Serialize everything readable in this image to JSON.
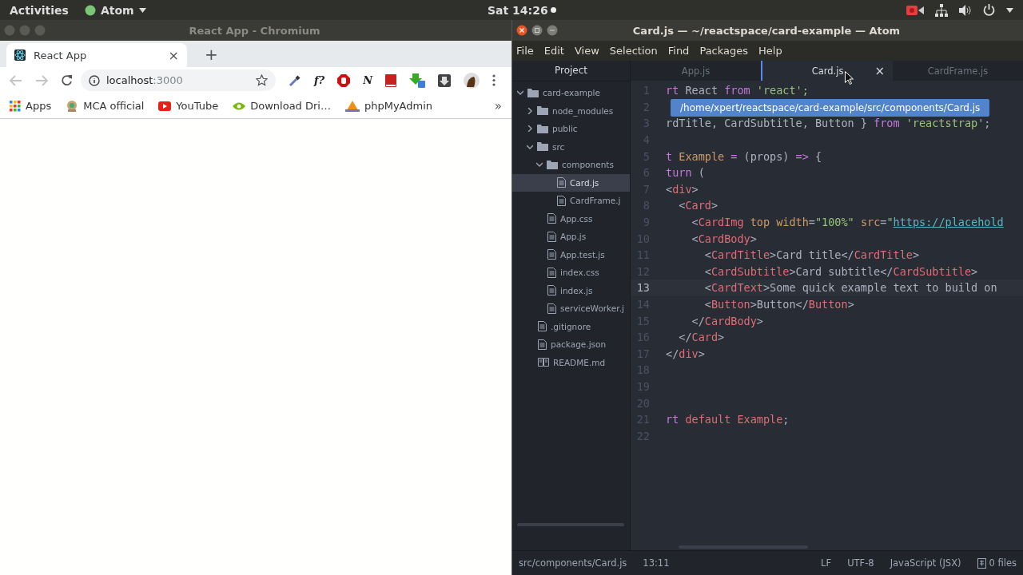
{
  "topbar": {
    "activities": "Activities",
    "app_menu": "Atom",
    "clock": "Sat 14:26"
  },
  "browser": {
    "title": "React App - Chromium",
    "tabs": [
      {
        "label": "React App",
        "close": "×",
        "selected": true
      }
    ],
    "new_tab": "+",
    "address": {
      "host": "localhost",
      "port": ":3000"
    },
    "extensions": [
      {
        "kind": "dropper"
      },
      {
        "kind": "text",
        "label": "f?"
      },
      {
        "kind": "stop"
      },
      {
        "kind": "text",
        "label": "N"
      },
      {
        "kind": "book"
      },
      {
        "kind": "green-download"
      },
      {
        "kind": "dark-download"
      },
      {
        "kind": "avatar"
      }
    ],
    "bookmarks": [
      {
        "kind": "apps",
        "label": "Apps"
      },
      {
        "kind": "emblem",
        "label": "MCA official"
      },
      {
        "kind": "youtube",
        "label": "YouTube"
      },
      {
        "kind": "eye",
        "label": "Download Dri…"
      },
      {
        "kind": "pma",
        "label": "phpMyAdmin"
      }
    ],
    "more": "»"
  },
  "atom": {
    "title": "Card.js — ~/reactspace/card-example — Atom",
    "menu": [
      "File",
      "Edit",
      "View",
      "Selection",
      "Find",
      "Packages",
      "Help"
    ],
    "project_tab": "Project",
    "tree": [
      {
        "name": "card-example",
        "kind": "folder",
        "expanded": true,
        "selected": false,
        "children": [
          {
            "name": "node_modules",
            "kind": "folder",
            "expanded": false,
            "selected": false
          },
          {
            "name": "public",
            "kind": "folder",
            "expanded": false,
            "selected": false
          },
          {
            "name": "src",
            "kind": "folder",
            "expanded": true,
            "selected": false,
            "children": [
              {
                "name": "components",
                "kind": "folder",
                "expanded": true,
                "selected": false,
                "children": [
                  {
                    "name": "Card.js",
                    "kind": "file",
                    "selected": true
                  },
                  {
                    "name": "CardFrame.j",
                    "kind": "file",
                    "selected": false
                  }
                ]
              },
              {
                "name": "App.css",
                "kind": "file",
                "selected": false
              },
              {
                "name": "App.js",
                "kind": "file",
                "selected": false
              },
              {
                "name": "App.test.js",
                "kind": "file",
                "selected": false
              },
              {
                "name": "index.css",
                "kind": "file",
                "selected": false
              },
              {
                "name": "index.js",
                "kind": "file",
                "selected": false
              },
              {
                "name": "serviceWorker.j",
                "kind": "file",
                "selected": false
              }
            ]
          },
          {
            "name": ".gitignore",
            "kind": "file",
            "selected": false
          },
          {
            "name": "package.json",
            "kind": "file",
            "selected": false
          },
          {
            "name": "README.md",
            "kind": "book",
            "selected": false
          }
        ]
      }
    ],
    "tabs": [
      {
        "label": "App.js",
        "selected": false
      },
      {
        "label": "Card.js",
        "selected": true,
        "close": "×"
      },
      {
        "label": "CardFrame.js",
        "selected": false
      }
    ],
    "tooltip": "/home/xpert/reactspace/card-example/src/components/Card.js",
    "lines": [
      {
        "n": "1",
        "current": false,
        "tokens": [
          {
            "kind": "kw",
            "t": "rt "
          },
          {
            "kind": "plain",
            "t": "React "
          },
          {
            "kind": "kw",
            "t": "from "
          },
          {
            "kind": "str",
            "t": "'react';"
          }
        ]
      },
      {
        "n": "2",
        "current": false
      },
      {
        "n": "3",
        "current": false,
        "tokens": [
          {
            "kind": "plain",
            "t": "rdTitle, CardSubtitle, Button } "
          },
          {
            "kind": "kw",
            "t": "from "
          },
          {
            "kind": "str",
            "t": "'reactstrap'"
          },
          {
            "kind": "plain",
            "t": ";"
          }
        ]
      },
      {
        "n": "4",
        "current": false
      },
      {
        "n": "5",
        "current": false,
        "tokens": [
          {
            "kind": "kw",
            "t": "t "
          },
          {
            "kind": "attr",
            "t": "Example "
          },
          {
            "kind": "kw",
            "t": "= "
          },
          {
            "kind": "plain",
            "t": "(props) "
          },
          {
            "kind": "kw",
            "t": "=> "
          },
          {
            "kind": "plain",
            "t": "{"
          }
        ]
      },
      {
        "n": "6",
        "current": false,
        "tokens": [
          {
            "kind": "kw",
            "t": "turn "
          },
          {
            "kind": "plain",
            "t": "("
          }
        ]
      },
      {
        "n": "7",
        "current": false,
        "tokens": [
          {
            "kind": "plain",
            "t": "<"
          },
          {
            "kind": "tag",
            "t": "div"
          },
          {
            "kind": "plain",
            "t": ">"
          }
        ]
      },
      {
        "n": "8",
        "current": false,
        "tokens": [
          {
            "kind": "plain",
            "t": "  <"
          },
          {
            "kind": "tag",
            "t": "Card"
          },
          {
            "kind": "plain",
            "t": ">"
          }
        ]
      },
      {
        "n": "9",
        "current": false,
        "tokens": [
          {
            "kind": "plain",
            "t": "    <"
          },
          {
            "kind": "tag",
            "t": "CardImg"
          },
          {
            "kind": "attr",
            "t": " top width"
          },
          {
            "kind": "plain",
            "t": "="
          },
          {
            "kind": "str",
            "t": "\"100%\""
          },
          {
            "kind": "attr",
            "t": " src"
          },
          {
            "kind": "plain",
            "t": "="
          },
          {
            "kind": "str",
            "t": "\""
          },
          {
            "kind": "link",
            "t": "https://placehold"
          }
        ]
      },
      {
        "n": "10",
        "current": false,
        "tokens": [
          {
            "kind": "plain",
            "t": "    <"
          },
          {
            "kind": "tag",
            "t": "CardBody"
          },
          {
            "kind": "plain",
            "t": ">"
          }
        ]
      },
      {
        "n": "11",
        "current": false,
        "tokens": [
          {
            "kind": "plain",
            "t": "      <"
          },
          {
            "kind": "tag",
            "t": "CardTitle"
          },
          {
            "kind": "plain",
            "t": ">Card title</"
          },
          {
            "kind": "tag",
            "t": "CardTitle"
          },
          {
            "kind": "plain",
            "t": ">"
          }
        ]
      },
      {
        "n": "12",
        "current": false,
        "tokens": [
          {
            "kind": "plain",
            "t": "      <"
          },
          {
            "kind": "tag",
            "t": "CardSubtitle"
          },
          {
            "kind": "plain",
            "t": ">Card subtitle</"
          },
          {
            "kind": "tag",
            "t": "CardSubtitle"
          },
          {
            "kind": "plain",
            "t": ">"
          }
        ]
      },
      {
        "n": "13",
        "current": true,
        "tokens": [
          {
            "kind": "plain",
            "t": "      <"
          },
          {
            "kind": "tag",
            "t": "CardText"
          },
          {
            "kind": "plain",
            "t": ">Some quick example text to build on"
          }
        ]
      },
      {
        "n": "14",
        "current": false,
        "tokens": [
          {
            "kind": "plain",
            "t": "      <"
          },
          {
            "kind": "tag",
            "t": "Button"
          },
          {
            "kind": "plain",
            "t": ">Button</"
          },
          {
            "kind": "tag",
            "t": "Button"
          },
          {
            "kind": "plain",
            "t": ">"
          }
        ]
      },
      {
        "n": "15",
        "current": false,
        "tokens": [
          {
            "kind": "plain",
            "t": "    </"
          },
          {
            "kind": "tag",
            "t": "CardBody"
          },
          {
            "kind": "plain",
            "t": ">"
          }
        ]
      },
      {
        "n": "16",
        "current": false,
        "tokens": [
          {
            "kind": "plain",
            "t": "  </"
          },
          {
            "kind": "tag",
            "t": "Card"
          },
          {
            "kind": "plain",
            "t": ">"
          }
        ]
      },
      {
        "n": "17",
        "current": false,
        "tokens": [
          {
            "kind": "plain",
            "t": "</"
          },
          {
            "kind": "tag",
            "t": "div"
          },
          {
            "kind": "plain",
            "t": ">"
          }
        ]
      },
      {
        "n": "18",
        "current": false
      },
      {
        "n": "19",
        "current": false
      },
      {
        "n": "20",
        "current": false
      },
      {
        "n": "21",
        "current": false,
        "tokens": [
          {
            "kind": "kw",
            "t": "rt "
          },
          {
            "kind": "tag",
            "t": "default Example"
          },
          {
            "kind": "plain",
            "t": ";"
          }
        ]
      },
      {
        "n": "22",
        "current": false
      }
    ],
    "status": {
      "path": "src/components/Card.js",
      "cursor": "13:11",
      "eol": "LF",
      "encoding": "UTF-8",
      "grammar": "JavaScript (JSX)",
      "files": "0 files"
    }
  }
}
